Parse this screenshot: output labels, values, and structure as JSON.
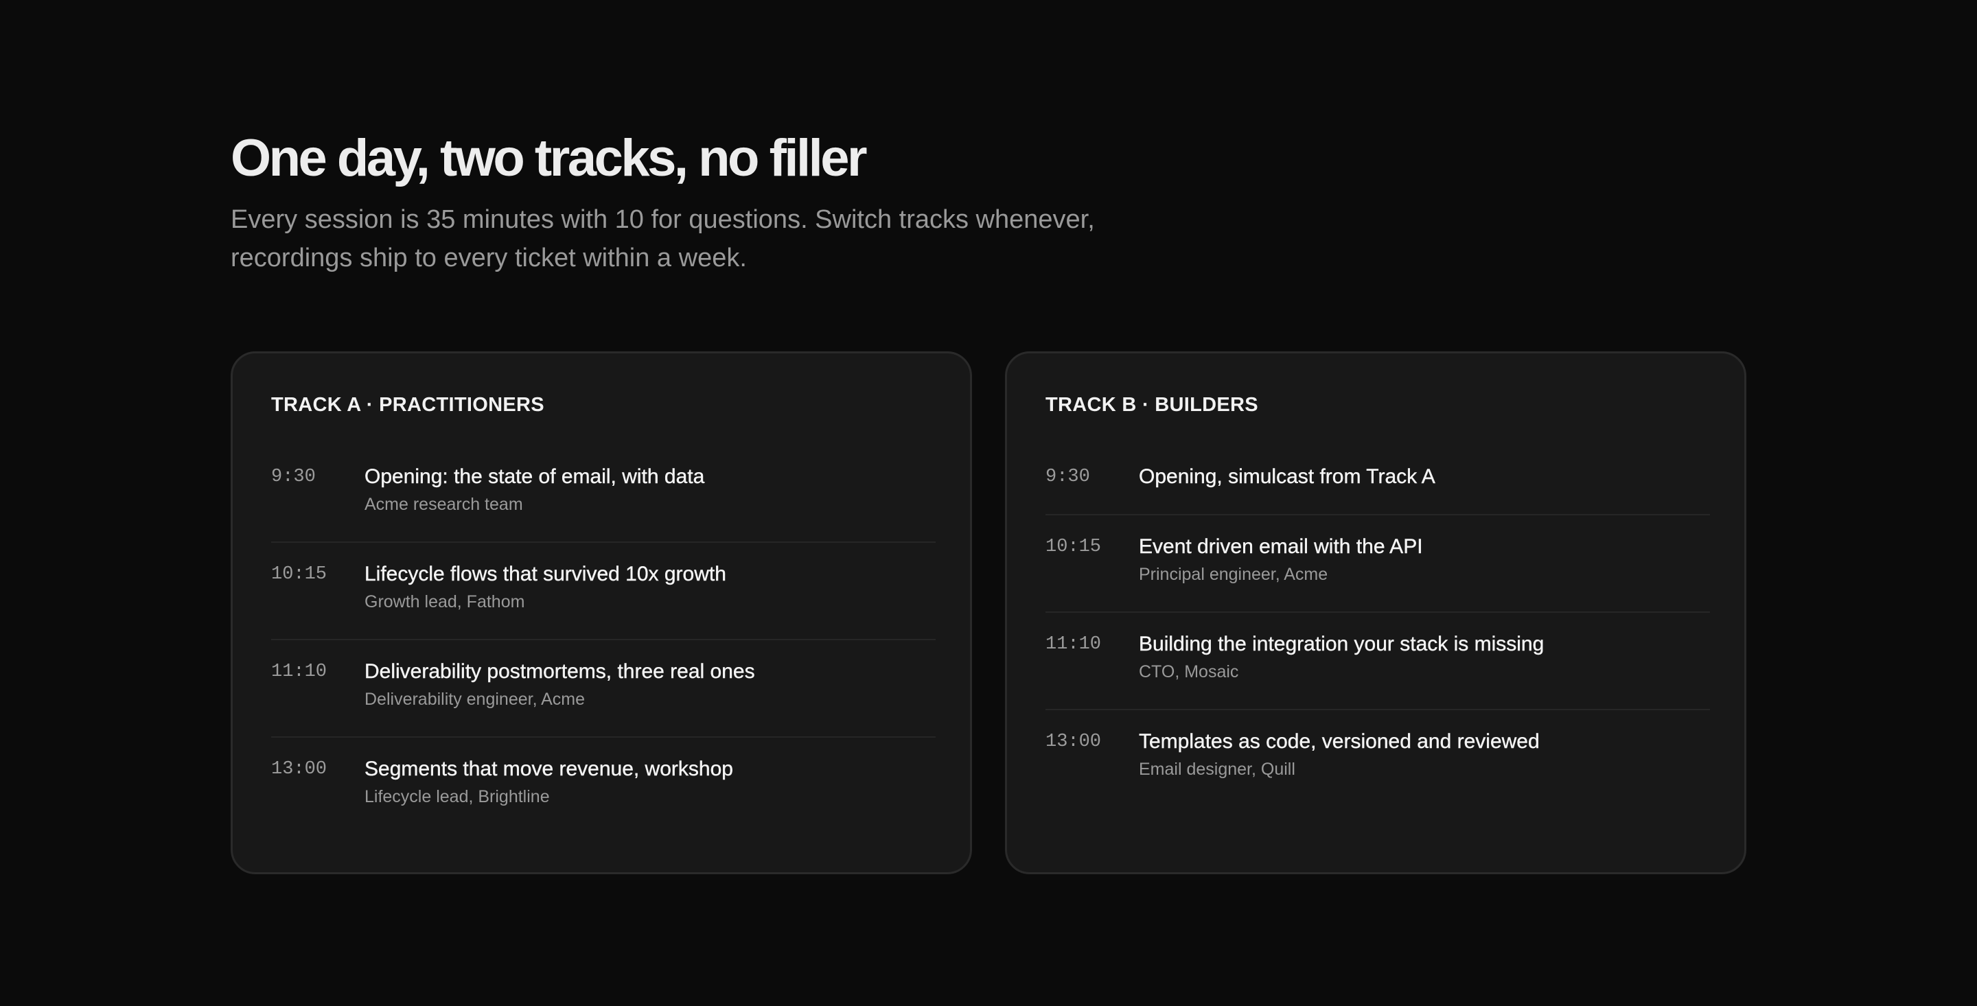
{
  "header": {
    "title": "One day, two tracks, no filler",
    "subtitle": "Every session is 35 minutes with 10 for questions. Switch tracks whenever, recordings ship to every ticket within a week."
  },
  "tracks": [
    {
      "label": "TRACK A · PRACTITIONERS",
      "sessions": [
        {
          "time": "9:30",
          "title": "Opening: the state of email, with data",
          "speaker": "Acme research team"
        },
        {
          "time": "10:15",
          "title": "Lifecycle flows that survived 10x growth",
          "speaker": "Growth lead, Fathom"
        },
        {
          "time": "11:10",
          "title": "Deliverability postmortems, three real ones",
          "speaker": "Deliverability engineer, Acme"
        },
        {
          "time": "13:00",
          "title": "Segments that move revenue, workshop",
          "speaker": "Lifecycle lead, Brightline"
        }
      ]
    },
    {
      "label": "TRACK B · BUILDERS",
      "sessions": [
        {
          "time": "9:30",
          "title": "Opening, simulcast from Track A",
          "speaker": ""
        },
        {
          "time": "10:15",
          "title": "Event driven email with the API",
          "speaker": "Principal engineer, Acme"
        },
        {
          "time": "11:10",
          "title": "Building the integration your stack is missing",
          "speaker": "CTO, Mosaic"
        },
        {
          "time": "13:00",
          "title": "Templates as code, versioned and reviewed",
          "speaker": "Email designer, Quill"
        }
      ]
    }
  ],
  "colors": {
    "background": "#0b0b0b",
    "card": "#181818",
    "card_border": "#2a2a2a",
    "text_primary": "#f2f2f2",
    "text_muted": "#9a9a9a"
  }
}
